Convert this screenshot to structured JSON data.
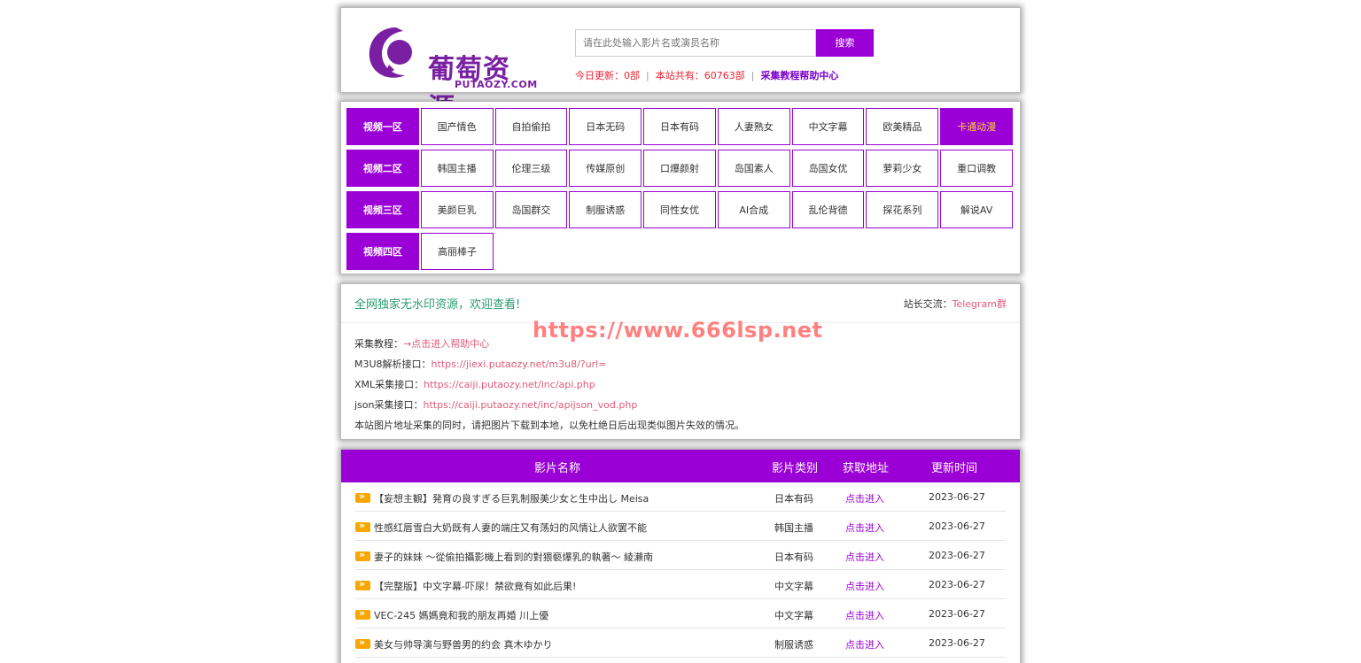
{
  "header": {
    "logo_cn": "葡萄资源",
    "logo_en": "PUTAOZY.COM",
    "search_placeholder": "请在此处输入影片名或演员名称",
    "search_button": "搜索",
    "stats_today_label": "今日更新：",
    "stats_today_value": "0部",
    "stats_total_label": "本站共有：",
    "stats_total_value": "60763部",
    "help_link": "采集教程帮助中心"
  },
  "nav": [
    {
      "zone": "视频一区",
      "cats": [
        "国产情色",
        "自拍偷拍",
        "日本无码",
        "日本有码",
        "人妻熟女",
        "中文字幕",
        "欧美精品",
        "卡通动漫"
      ]
    },
    {
      "zone": "视频二区",
      "cats": [
        "韩国主播",
        "伦理三级",
        "传媒原创",
        "口爆颜射",
        "岛国素人",
        "岛国女优",
        "萝莉少女",
        "重口调教"
      ]
    },
    {
      "zone": "视频三区",
      "cats": [
        "美颜巨乳",
        "岛国群交",
        "制服诱惑",
        "同性女优",
        "AI合成",
        "乱伦背德",
        "探花系列",
        "解说AV"
      ]
    },
    {
      "zone": "视频四区",
      "cats": [
        "高丽棒子"
      ]
    }
  ],
  "notice": {
    "title": "全网独家无水印资源，欢迎查看!",
    "contact_label": "站长交流：",
    "contact_link": "Telegram群",
    "watermark": "https://www.666lsp.net",
    "lines": [
      {
        "label": "采集教程：",
        "link": "→点击进入帮助中心"
      },
      {
        "label": "M3U8解析接口：",
        "link": "https://jiexi.putaozy.net/m3u8/?url="
      },
      {
        "label": "XML采集接口：",
        "link": "https://caiji.putaozy.net/inc/api.php"
      },
      {
        "label": "json采集接口：",
        "link": "https://caiji.putaozy.net/inc/apijson_vod.php"
      }
    ],
    "footnote": "本站图片地址采集的同时，请把图片下载到本地，以免杜绝日后出现类似图片失效的情况。"
  },
  "list": {
    "headers": [
      "影片名称",
      "影片类别",
      "获取地址",
      "更新时间"
    ],
    "rows": [
      {
        "title": "【妄想主観】発育の良すぎる巨乳制服美少女と生中出し Meisa",
        "type": "日本有码",
        "get": "点击进入",
        "date": "2023-06-27"
      },
      {
        "title": "性感红唇雪白大奶既有人妻的端庄又有荡妇的风情让人欲罢不能",
        "type": "韩国主播",
        "get": "点击进入",
        "date": "2023-06-27"
      },
      {
        "title": "妻子的妹妹 ～從偷拍攝影機上看到的對猥褻爆乳的執著～ 綾瀨南",
        "type": "日本有码",
        "get": "点击进入",
        "date": "2023-06-27"
      },
      {
        "title": "【完整版】中文字幕-吓尿！禁欲竟有如此后果!",
        "type": "中文字幕",
        "get": "点击进入",
        "date": "2023-06-27"
      },
      {
        "title": "VEC-245 媽媽竟和我的朋友再婚 川上優",
        "type": "中文字幕",
        "get": "点击进入",
        "date": "2023-06-27"
      },
      {
        "title": "美女与帅导演与野兽男的约会 真木ゆかり",
        "type": "制服诱惑",
        "get": "点击进入",
        "date": "2023-06-27"
      }
    ]
  },
  "colors": {
    "accent": "#9a00d6",
    "link": "#e05a7a",
    "notice_title": "#2a9d6e"
  }
}
